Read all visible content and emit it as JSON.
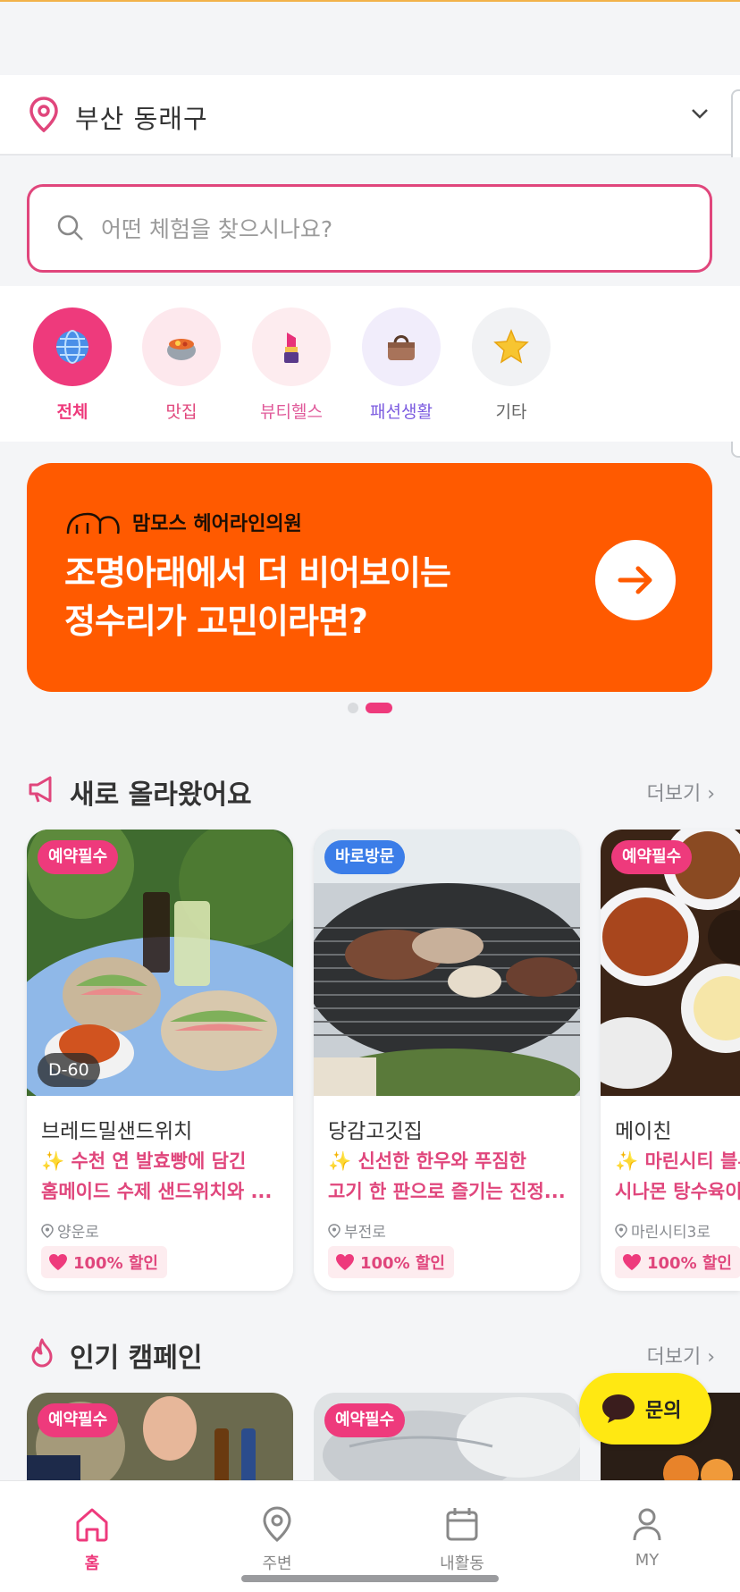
{
  "location": {
    "label": "부산 동래구"
  },
  "search": {
    "placeholder": "어떤 체험을 찾으시나요?"
  },
  "categories": [
    {
      "label": "전체",
      "icon": "globe-icon",
      "color": "#ee3a7c"
    },
    {
      "label": "맛집",
      "icon": "food-pot-icon",
      "color": "#e0467c"
    },
    {
      "label": "뷰티헬스",
      "icon": "lipstick-icon",
      "color": "#e05a9a"
    },
    {
      "label": "패션생활",
      "icon": "handbag-icon",
      "color": "#7c5ce0"
    },
    {
      "label": "기타",
      "icon": "star-icon",
      "color": "#666666"
    }
  ],
  "banner": {
    "brand": "맘모스 헤어라인의원",
    "line1": "조명아래에서 더 비어보이는",
    "line2": "정수리가 고민이라면?"
  },
  "new_section": {
    "title": "새로 올라왔어요",
    "more": "더보기"
  },
  "new_cards": [
    {
      "badge": "예약필수",
      "dday": "D-60",
      "name": "브레드밀샌드위치",
      "desc1": "✨ 수천 연 발효빵에 담긴",
      "desc2": "홈메이드 수제 샌드위치와 ...",
      "loc": "양운로",
      "discount": "100% 할인"
    },
    {
      "badge": "바로방문",
      "name": "당감고깃집",
      "desc1": "✨ 신선한 한우와 푸짐한",
      "desc2": "고기 한 판으로 즐기는 진정...",
      "loc": "부전로",
      "discount": "100% 할인"
    },
    {
      "badge": "예약필수",
      "name": "메이친",
      "desc1": "✨ 마린시티 블루",
      "desc2": "시나몬 탕수육이",
      "loc": "마린시티3로",
      "discount": "100% 할인"
    }
  ],
  "popular_section": {
    "title": "인기 캠페인",
    "more": "더보기"
  },
  "popular_cards": [
    {
      "badge": "예약필수"
    },
    {
      "badge": "예약필수"
    }
  ],
  "inquiry": {
    "label": "문의"
  },
  "nav": [
    {
      "label": "홈",
      "active": true
    },
    {
      "label": "주변"
    },
    {
      "label": "내활동"
    },
    {
      "label": "MY"
    }
  ]
}
